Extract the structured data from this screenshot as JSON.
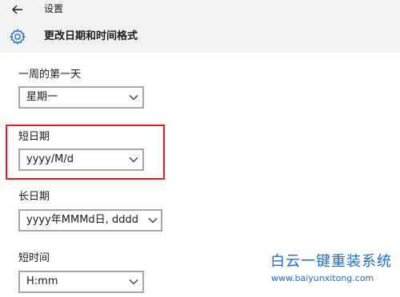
{
  "app": {
    "title": "设置"
  },
  "page": {
    "title": "更改日期和时间格式"
  },
  "icons": {
    "back": "back-arrow-icon",
    "settings": "gear-icon",
    "dropdown": "chevron-down-icon"
  },
  "fields": {
    "first_day": {
      "label": "一周的第一天",
      "value": "星期一"
    },
    "short_date": {
      "label": "短日期",
      "value": "yyyy/M/d"
    },
    "long_date": {
      "label": "长日期",
      "value": "yyyy年MMMd日, dddd"
    },
    "short_time": {
      "label": "短时间",
      "value": "H:mm"
    }
  },
  "watermark": {
    "title": "白云一键重装系统",
    "url": "www.baiyunxitong.com"
  },
  "colors": {
    "accent": "#1f6fc4",
    "highlight": "#e11e26",
    "header_bg": "#f2f2f2"
  }
}
